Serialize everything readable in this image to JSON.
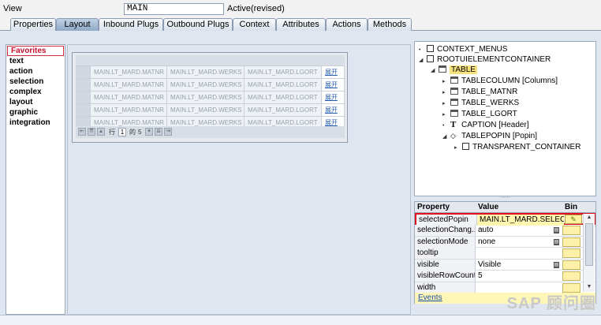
{
  "header": {
    "view_label": "View",
    "view_value": "MAIN",
    "status": "Active(revised)"
  },
  "tabs": [
    {
      "label": "Properties",
      "active": false
    },
    {
      "label": "Layout",
      "active": true
    },
    {
      "label": "Inbound Plugs",
      "active": false
    },
    {
      "label": "Outbound Plugs",
      "active": false
    },
    {
      "label": "Context",
      "active": false
    },
    {
      "label": "Attributes",
      "active": false
    },
    {
      "label": "Actions",
      "active": false
    },
    {
      "label": "Methods",
      "active": false
    }
  ],
  "categories": [
    "Favorites",
    "text",
    "action",
    "selection",
    "complex",
    "layout",
    "graphic",
    "integration"
  ],
  "canvas_table": {
    "rows": [
      [
        "MAIN.LT_MARD.MATNR",
        "MAIN.LT_MARD.WERKS",
        "MAIN.LT_MARD.LGORT",
        "展开"
      ],
      [
        "MAIN.LT_MARD.MATNR",
        "MAIN.LT_MARD.WERKS",
        "MAIN.LT_MARD.LGORT",
        "展开"
      ],
      [
        "MAIN.LT_MARD.MATNR",
        "MAIN.LT_MARD.WERKS",
        "MAIN.LT_MARD.LGORT",
        "展开"
      ],
      [
        "MAIN.LT_MARD.MATNR",
        "MAIN.LT_MARD.WERKS",
        "MAIN.LT_MARD.LGORT",
        "展开"
      ],
      [
        "MAIN.LT_MARD.MATNR",
        "MAIN.LT_MARD.WERKS",
        "MAIN.LT_MARD.LGORT",
        "展开"
      ]
    ],
    "pager": {
      "row_label": "行",
      "current": "1",
      "of_label": "的",
      "total": "5"
    }
  },
  "tree": {
    "nodes": [
      {
        "label": "CONTEXT_MENUS",
        "icon": "box-icon"
      },
      {
        "label": "ROOTUIELEMENTCONTAINER",
        "icon": "box-icon"
      },
      {
        "label": "TABLE",
        "icon": "table-icon"
      },
      {
        "label": "TABLECOLUMN  [Columns]",
        "icon": "table-icon"
      },
      {
        "label": "TABLE_MATNR",
        "icon": "table-icon"
      },
      {
        "label": "TABLE_WERKS",
        "icon": "table-icon"
      },
      {
        "label": "TABLE_LGORT",
        "icon": "table-icon"
      },
      {
        "label": "CAPTION  [Header]",
        "icon": "text-t-icon"
      },
      {
        "label": "TABLEPOPIN  [Popin]",
        "icon": "diamond-icon"
      },
      {
        "label": "TRANSPARENT_CONTAINER",
        "icon": "box-icon"
      }
    ]
  },
  "properties": {
    "headers": {
      "property": "Property",
      "value": "Value",
      "bind": "Bin"
    },
    "rows": [
      {
        "name": "selectedPopin",
        "value": "MAIN.LT_MARD.SELEC..."
      },
      {
        "name": "selectionChang...",
        "value": "auto"
      },
      {
        "name": "selectionMode",
        "value": "none"
      },
      {
        "name": "tooltip",
        "value": ""
      },
      {
        "name": "visible",
        "value": "Visible"
      },
      {
        "name": "visibleRowCount",
        "value": "5"
      },
      {
        "name": "width",
        "value": ""
      }
    ],
    "events_label": "Events"
  },
  "watermark": "SAP 顾问圈"
}
